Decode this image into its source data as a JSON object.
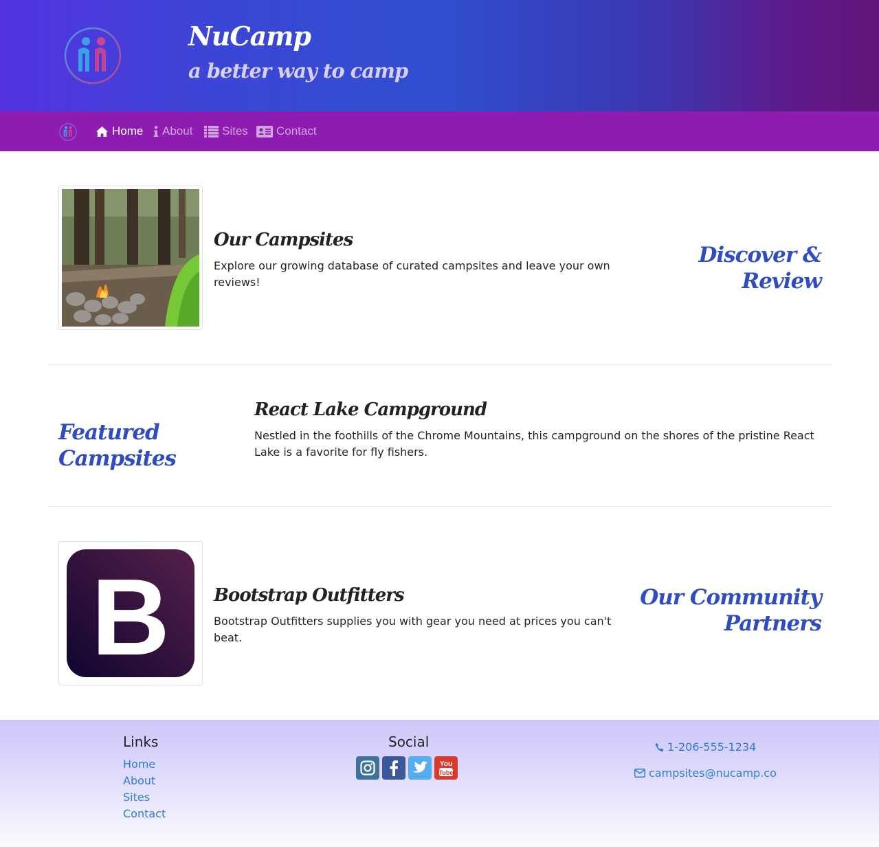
{
  "header": {
    "title": "NuCamp",
    "subtitle": "a better way to camp"
  },
  "nav": {
    "items": [
      {
        "label": "Home",
        "icon": "home-icon",
        "active": true
      },
      {
        "label": "About",
        "icon": "info-icon",
        "active": false
      },
      {
        "label": "Sites",
        "icon": "list-icon",
        "active": false
      },
      {
        "label": "Contact",
        "icon": "address-card-icon",
        "active": false
      }
    ]
  },
  "sections": {
    "campsites": {
      "title": "Our Campsites",
      "text": "Explore our growing database of curated campsites and leave your own reviews!",
      "side_heading": "Discover & Review"
    },
    "featured": {
      "side_heading": "Featured Campsites",
      "title": "React Lake Campground",
      "text": "Nestled in the foothills of the Chrome Mountains, this campground on the shores of the pristine React Lake is a favorite for fly fishers."
    },
    "partners": {
      "title": "Bootstrap Outfitters",
      "text": "Bootstrap Outfitters supplies you with gear you need at prices you can't beat.",
      "side_heading_line1": "Our Community",
      "side_heading_line2": "Partners",
      "logo_letter": "B"
    }
  },
  "footer": {
    "links_heading": "Links",
    "links": [
      "Home",
      "About",
      "Sites",
      "Contact"
    ],
    "social_heading": "Social",
    "social": [
      {
        "name": "instagram",
        "color": "#3f729b"
      },
      {
        "name": "facebook",
        "color": "#3b5998"
      },
      {
        "name": "twitter",
        "color": "#55acee"
      },
      {
        "name": "youtube",
        "color": "#bb0000"
      }
    ],
    "phone": "1-206-555-1234",
    "email": "campsites@nucamp.co"
  },
  "colors": {
    "navbar": "#8e1cb0",
    "accent_heading": "#2f4cc0",
    "link": "#2f7bd8"
  }
}
